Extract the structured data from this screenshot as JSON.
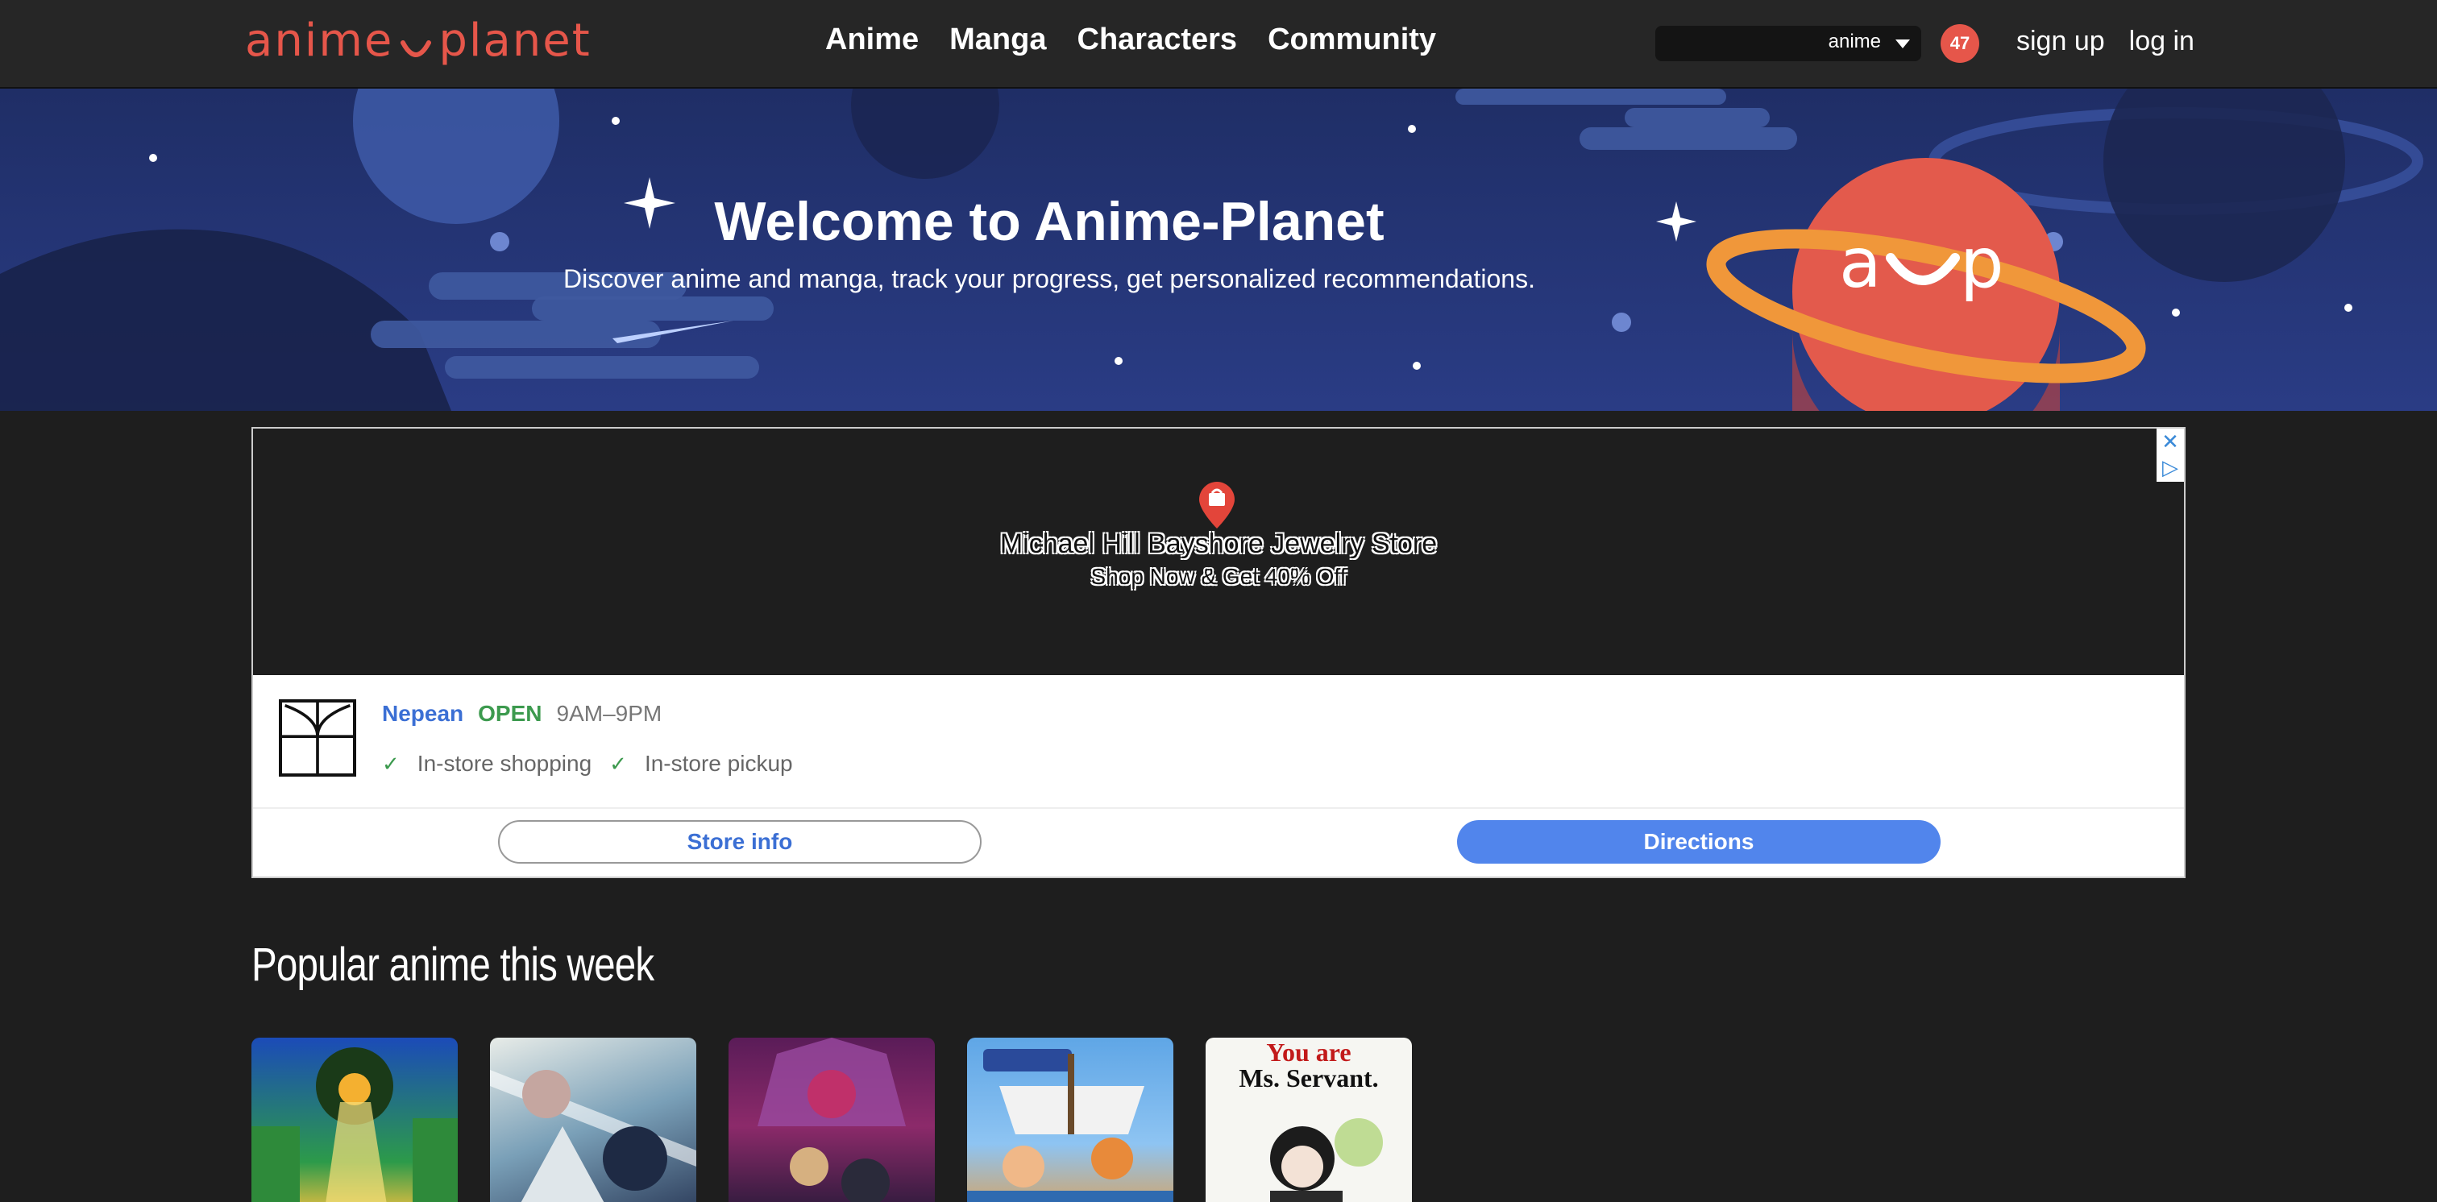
{
  "nav": {
    "logo_text_left": "anime",
    "logo_text_right": "planet",
    "links": [
      "Anime",
      "Manga",
      "Characters",
      "Community"
    ],
    "search": {
      "selected": "anime"
    },
    "badge_count": "47",
    "sign_up": "sign up",
    "log_in": "log in",
    "brand_color": "#e6564a"
  },
  "hero": {
    "title": "Welcome to Anime-Planet",
    "subtitle": "Discover anime and manga, track your progress, get personalized recommendations."
  },
  "ad": {
    "store_name": "Michael Hill Bayshore Jewelry Store",
    "offer": "Shop Now & Get 40% Off",
    "location": "Nepean",
    "status": "OPEN",
    "hours": "9AM–9PM",
    "features": [
      "In-store shopping",
      "In-store pickup"
    ],
    "store_info_label": "Store info",
    "directions_label": "Directions"
  },
  "popular": {
    "title": "Popular anime this week",
    "cards": [
      {
        "name": "anime-cover-1",
        "text": ""
      },
      {
        "name": "anime-cover-2",
        "text": ""
      },
      {
        "name": "anime-cover-3",
        "text": ""
      },
      {
        "name": "anime-cover-4",
        "text": ""
      },
      {
        "name": "anime-cover-5",
        "text_line1": "You are",
        "text_line2": "Ms. Servant."
      }
    ]
  }
}
